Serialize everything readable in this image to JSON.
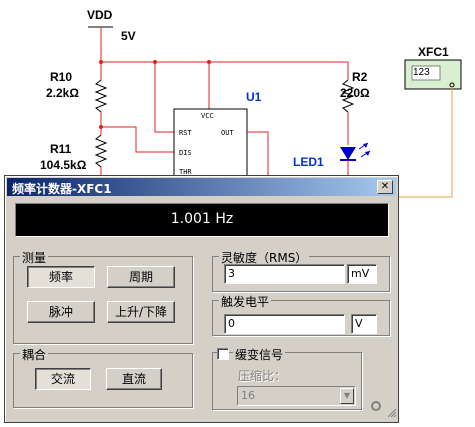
{
  "schematic": {
    "vdd_label": "VDD",
    "vdd_value": "5V",
    "r10_name": "R10",
    "r10_value": "2.2kΩ",
    "r11_name": "R11",
    "r11_value": "104.5kΩ",
    "r2_name": "R2",
    "r2_value": "220Ω",
    "u1_name": "U1",
    "chip_vcc": "VCC",
    "chip_rst": "RST",
    "chip_out": "OUT",
    "chip_dis": "DIS",
    "chip_thr": "THR",
    "led_name": "LED1",
    "xfc_name": "XFC1",
    "xfc_display": "123",
    "colors": {
      "wire_red": "#e02020",
      "wire_orange": "#f0a040",
      "text_blue": "#0033cc"
    }
  },
  "dialog": {
    "title": "频率计数器-XFC1",
    "close_icon": "close-icon",
    "reading": "1.001 Hz",
    "measure": {
      "label": "测量",
      "frequency_button": "频率",
      "period_button": "周期",
      "pulse_button": "脉冲",
      "rise_fall_button": "上升/下降",
      "selected": "频率"
    },
    "coupling": {
      "label": "耦合",
      "ac_button": "交流",
      "dc_button": "直流",
      "selected": "交流"
    },
    "sensitivity": {
      "label": "灵敏度（RMS）",
      "value": "3",
      "unit": "mV"
    },
    "trigger": {
      "label": "触发电平",
      "value": "0",
      "unit": "V"
    },
    "slow_change": {
      "label": "缓变信号",
      "checked": false,
      "ratio_label": "压缩比：",
      "ratio_value": "16"
    }
  }
}
